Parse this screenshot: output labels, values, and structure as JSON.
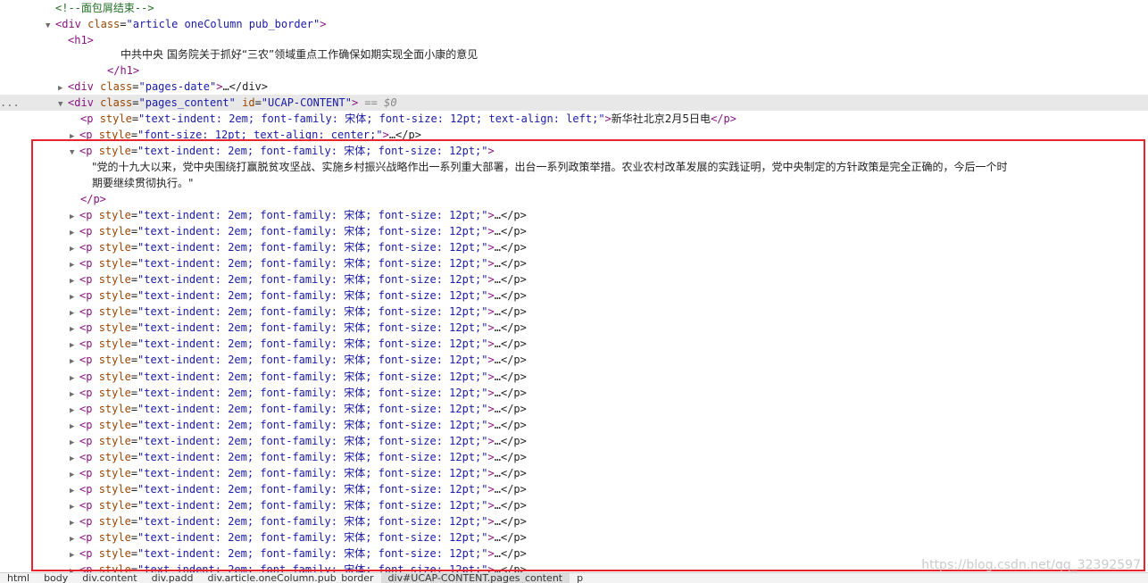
{
  "elements": {
    "comment": "<!--面包屑结束-->",
    "article_div": {
      "tag": "div",
      "class_attr": "class",
      "class_val": "\"article oneColumn pub_border\""
    },
    "h1_open": "<h1>",
    "h1_text": "中共中央 国务院关于抓好“三农”领域重点工作确保如期实现全面小康的意见",
    "h1_close": "</h1>",
    "date_div": {
      "class_attr": "class",
      "class_val": "\"pages-date\"",
      "ellipsis": "…</div>"
    },
    "content_div": {
      "class_attr": "class",
      "class_val": "\"pages_content\"",
      "id_attr": "id",
      "id_val": "\"UCAP-CONTENT\"",
      "eq": "== $0",
      "dots": "..."
    },
    "p_first": {
      "style_val": "\"text-indent: 2em; font-family: 宋体; font-size: 12pt; text-align: left;\"",
      "text": "新华社北京2月5日电"
    },
    "p_center": {
      "style_val": "\"font-size: 12pt; text-align: center;\""
    },
    "p_expanded": {
      "style_val": "\"text-indent: 2em; font-family: 宋体; font-size: 12pt;\"",
      "text_line1": "\"党的十九大以来，党中央围绕打赢脱贫攻坚战、实施乡村振兴战略作出一系列重大部署，出台一系列政策举措。农业农村改革发展的实践证明，党中央制定的方针政策是完全正确的，今后一个时",
      "text_line2": "期要继续贯彻执行。\"",
      "close": "</p>"
    },
    "p_collapsed": {
      "style_attr": "style",
      "style_val": "\"text-indent: 2em; font-family: 宋体; font-size: 12pt;\"",
      "ellipsis": "…</p>"
    }
  },
  "breadcrumbs": [
    "html",
    "body",
    "div.content",
    "div.padd",
    "div.article.oneColumn.pub_border",
    "div#UCAP-CONTENT.pages_content",
    "p"
  ],
  "watermark": "https://blog.csdn.net/qq_32392597",
  "colors": {
    "highlight_box": "#e8252c",
    "tag": "#881280",
    "attr_name": "#994500",
    "attr_value": "#1a1aa6",
    "comment": "#236e25"
  },
  "icons": {
    "expanded": "triangle-down-icon",
    "collapsed": "triangle-right-icon"
  }
}
